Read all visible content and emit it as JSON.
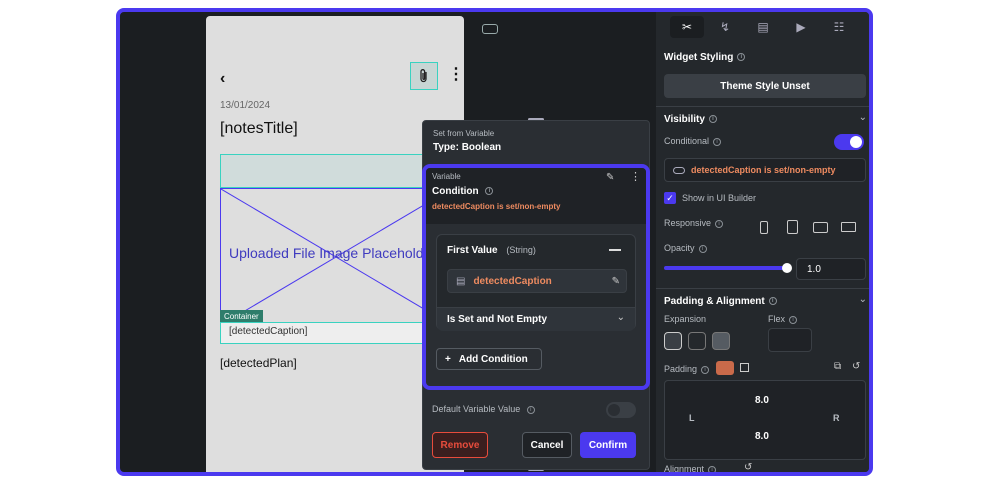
{
  "canvas": {
    "date": "13/01/2024",
    "notes_title": "[notesTitle]",
    "image_placeholder": "Uploaded File Image Placeholder",
    "container_tag": "Container",
    "detected_caption": "[detectedCaption]",
    "detected_plan": "[detectedPlan]"
  },
  "dialog": {
    "set_from_variable": "Set from Variable",
    "type_label": "Type: Boolean",
    "variable_label": "Variable",
    "condition_label": "Condition",
    "condition_expr": "detectedCaption is set/non-empty",
    "first_value_label": "First Value",
    "first_value_type": "(String)",
    "first_value_var": "detectedCaption",
    "operator": "Is Set and Not Empty",
    "add_condition": "Add Condition",
    "default_variable_value": "Default Variable Value",
    "remove": "Remove",
    "cancel": "Cancel",
    "confirm": "Confirm"
  },
  "panel": {
    "widget_styling": "Widget Styling",
    "theme_style": "Theme Style Unset",
    "visibility": "Visibility",
    "conditional": "Conditional",
    "conditional_expr": "detectedCaption is set/non-empty",
    "show_in_builder": "Show in UI Builder",
    "responsive": "Responsive",
    "opacity": "Opacity",
    "opacity_value": "1.0",
    "opacity_level": 1.0,
    "padding_alignment": "Padding & Alignment",
    "expansion": "Expansion",
    "flex": "Flex",
    "padding": "Padding",
    "pad_top": "8.0",
    "pad_bottom": "8.0",
    "pad_left": "L",
    "pad_right": "R",
    "alignment": "Alignment"
  },
  "colors": {
    "accent": "#4b39ef",
    "teal": "#39d2c0",
    "orange": "#ee8b60",
    "danger": "#e74c3c"
  }
}
